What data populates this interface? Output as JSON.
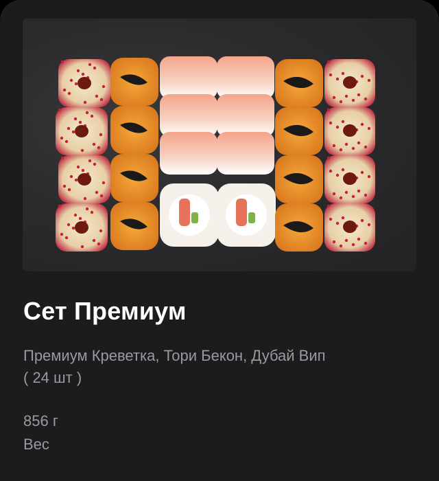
{
  "product": {
    "title": "Сет Премиум",
    "description_line1": "Премиум Креветка, Тори Бекон, Дубай Вип",
    "description_line2": "( 24 шт )",
    "weight_value": "856 г",
    "weight_label": "Вес"
  },
  "colors": {
    "card_background": "#1c1c1e",
    "title": "#ffffff",
    "secondary_text": "#9a9a9e"
  }
}
